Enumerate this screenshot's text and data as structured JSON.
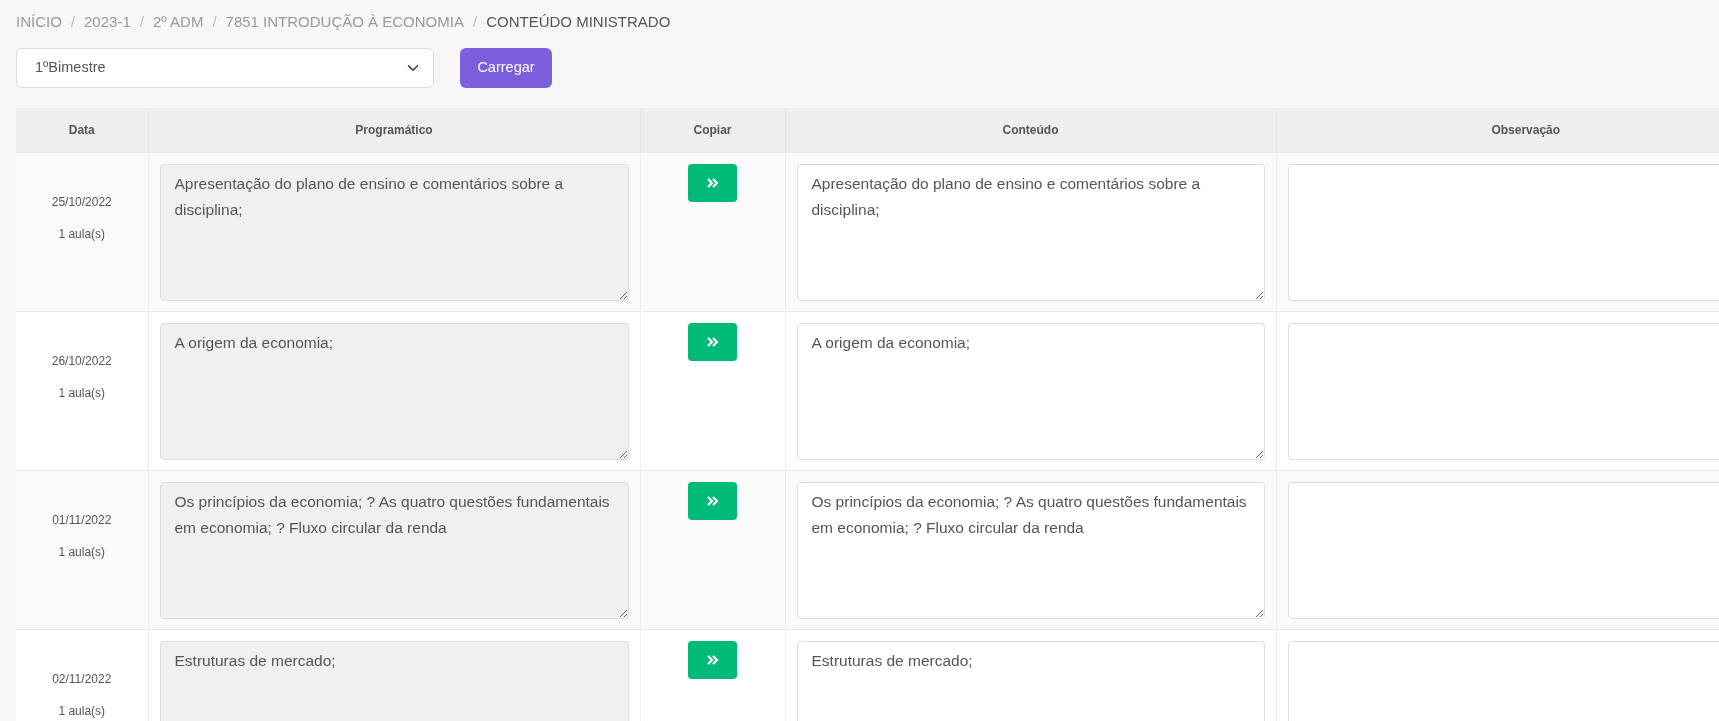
{
  "breadcrumb": [
    {
      "label": "INÍCIO",
      "active": false
    },
    {
      "separator": "/",
      "label": "2023-1",
      "active": false
    },
    {
      "separator": "/",
      "label": "2º ADM",
      "active": false
    },
    {
      "separator": "/",
      "label": "7851 INTRODUÇÃO À ECONOMIA",
      "active": false
    },
    {
      "separator": "/",
      "label": "CONTEÚDO MINISTRADO",
      "active": true
    }
  ],
  "period_select": {
    "value": "1ºBimestre"
  },
  "load_button": "Carregar",
  "table": {
    "columns": [
      "Data",
      "Programático",
      "Copiar",
      "Conteúdo",
      "Observação"
    ],
    "rows": [
      {
        "date": "25/10/2022",
        "lessons": "1 aula(s)",
        "programmatic": "Apresentação do plano de ensino e comentários sobre a disciplina;",
        "content": "Apresentação do plano de ensino e comentários sobre a disciplina;"
      },
      {
        "date": "26/10/2022",
        "lessons": "1 aula(s)",
        "programmatic": "A origem da economia;",
        "content": "A origem da economia;"
      },
      {
        "date": "01/11/2022",
        "lessons": "1 aula(s)",
        "programmatic": "Os princípios da economia; ? As quatro questões fundamentais em economia; ? Fluxo circular da renda",
        "content": "Os princípios da economia; ? As quatro questões fundamentais em economia; ? Fluxo circular da renda"
      },
      {
        "date": "02/11/2022",
        "lessons": "1 aula(s)",
        "programmatic": "Estruturas de mercado;",
        "content": "Estruturas de mercado;"
      }
    ]
  }
}
